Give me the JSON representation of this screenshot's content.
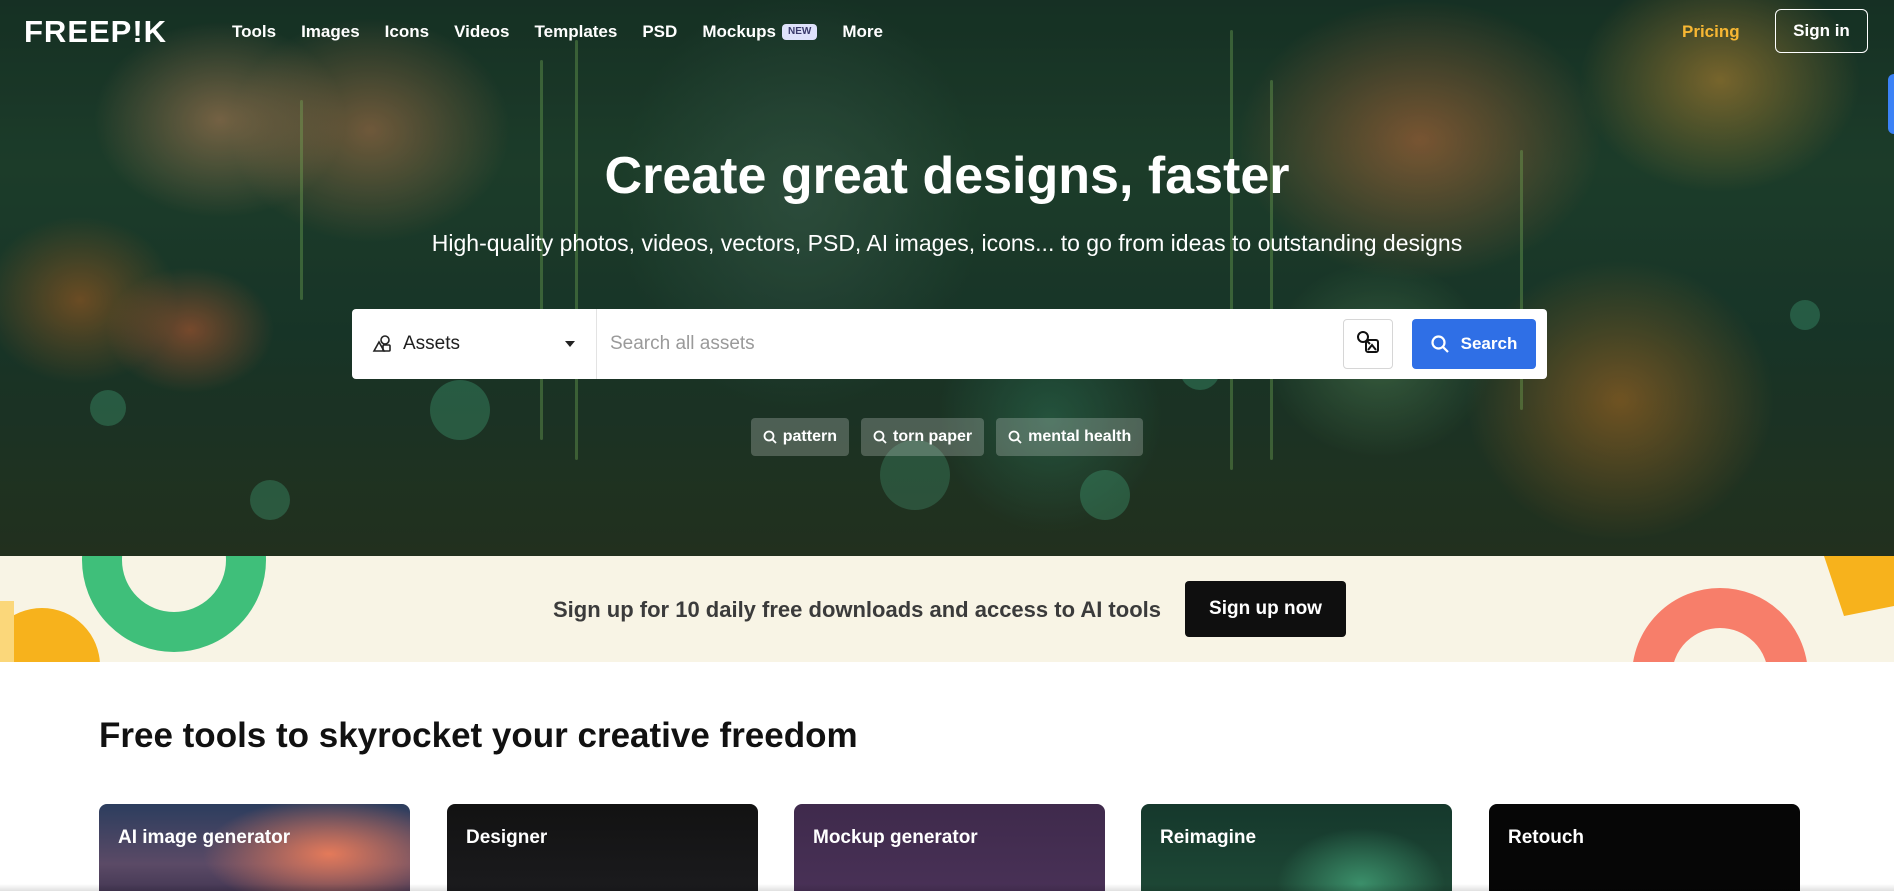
{
  "brand": {
    "logo_text": "FREEP!K"
  },
  "nav": {
    "links": [
      {
        "label": "Tools"
      },
      {
        "label": "Images"
      },
      {
        "label": "Icons"
      },
      {
        "label": "Videos"
      },
      {
        "label": "Templates"
      },
      {
        "label": "PSD"
      },
      {
        "label": "Mockups",
        "badge": "NEW"
      },
      {
        "label": "More"
      }
    ],
    "pricing_label": "Pricing",
    "signin_label": "Sign in"
  },
  "hero": {
    "title": "Create great designs, faster",
    "subtitle": "High-quality photos, videos, vectors, PSD, AI images, icons... to go from ideas to outstanding designs"
  },
  "search": {
    "category_label": "Assets",
    "placeholder": "Search all assets",
    "button_label": "Search",
    "suggestions": [
      {
        "label": "pattern"
      },
      {
        "label": "torn paper"
      },
      {
        "label": "mental health"
      }
    ]
  },
  "banner": {
    "text": "Sign up for 10 daily free downloads and access to AI tools",
    "button_label": "Sign up now"
  },
  "tools": {
    "title": "Free tools to skyrocket your creative freedom",
    "cards": [
      {
        "label": "AI image generator"
      },
      {
        "label": "Designer"
      },
      {
        "label": "Mockup generator"
      },
      {
        "label": "Reimagine"
      },
      {
        "label": "Retouch"
      }
    ]
  },
  "colors": {
    "accent_blue": "#2f6fe6",
    "pricing_yellow": "#f7b733",
    "banner_bg": "#f8f4e5"
  }
}
